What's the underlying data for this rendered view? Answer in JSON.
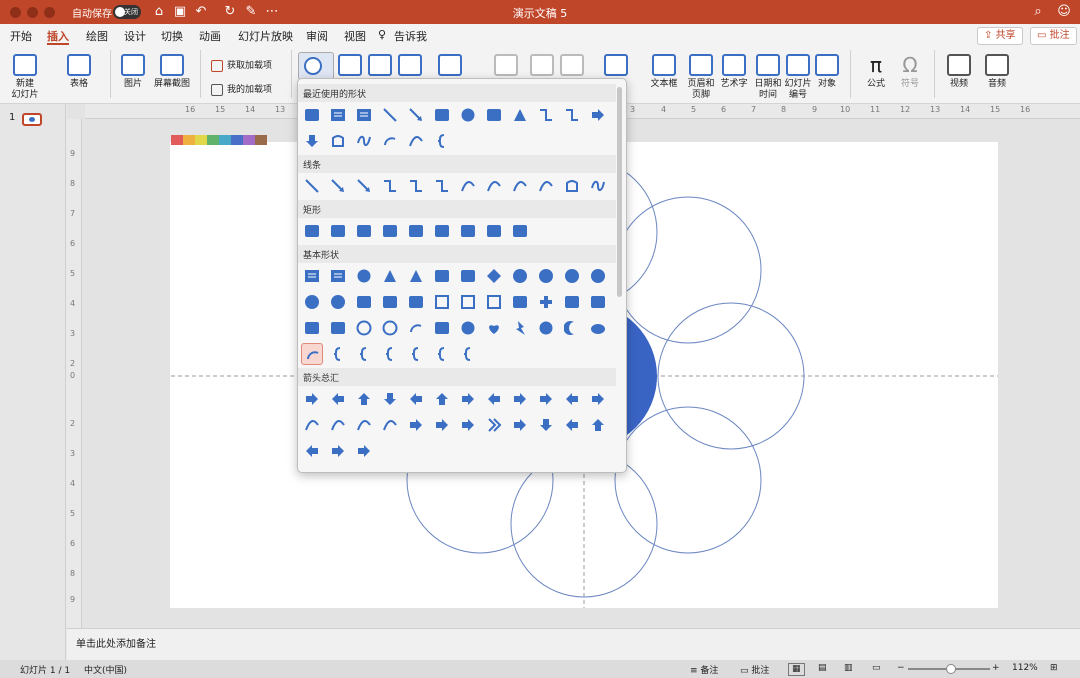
{
  "window": {
    "title": "演示文稿 5",
    "autosave_label": "自动保存",
    "autosave_state": "关闭"
  },
  "tabs": [
    "开始",
    "插入",
    "绘图",
    "设计",
    "切换",
    "动画",
    "幻灯片放映",
    "审阅",
    "视图"
  ],
  "active_tab": "插入",
  "tell_me": "告诉我",
  "share_button": "共享",
  "comment_button": "批注",
  "ribbon": {
    "new_slide": [
      "新建",
      "幻灯片"
    ],
    "table": "表格",
    "picture": "图片",
    "screenshot": "屏幕截图",
    "get_addins": "获取加载项",
    "my_addins": "我的加载项",
    "textbox": "文本框",
    "header_footer": [
      "页眉和",
      "页脚"
    ],
    "wordart": "艺术字",
    "datetime": [
      "日期和",
      "时间"
    ],
    "slide_number": [
      "幻灯片",
      "编号"
    ],
    "object": "对象",
    "equation": "公式",
    "symbol": "符号",
    "video": "视频",
    "audio": "音频"
  },
  "theme_palette": [
    "#e15b5b",
    "#f0b03f",
    "#e0d84a",
    "#5fb36a",
    "#4aa8c8",
    "#4a6fc8",
    "#a36cc8",
    "#9a6b4a"
  ],
  "shapes_menu": {
    "sections": [
      {
        "title": "最近使用的形状",
        "rows": [
          [
            "rect",
            "textbox",
            "vtextbox",
            "line",
            "arrow-line",
            "rect",
            "oval",
            "rounded-rect",
            "triangle",
            "elbow",
            "elbow-arrow",
            "right-arrow"
          ],
          [
            "down-arrow",
            "freeform",
            "scribble",
            "arc",
            "curve",
            "left-brace"
          ]
        ]
      },
      {
        "title": "线条",
        "rows": [
          [
            "line",
            "arrow-line",
            "double-arrow-line",
            "elbow",
            "elbow-arrow",
            "elbow-double",
            "curved",
            "curved-arrow",
            "curved-double",
            "curve",
            "freeform",
            "scribble"
          ]
        ]
      },
      {
        "title": "矩形",
        "rows": [
          [
            "rect",
            "rounded-rect",
            "snip-rect",
            "snip2-rect",
            "snip-round-rect",
            "round1-rect",
            "round2-rect",
            "round-diag-rect",
            "rounded-rect"
          ]
        ]
      },
      {
        "title": "基本形状",
        "rows": [
          [
            "textbox",
            "vtextbox",
            "oval",
            "triangle",
            "right-triangle",
            "parallelogram",
            "trapezoid",
            "diamond",
            "pentagon",
            "hexagon",
            "heptagon",
            "octagon"
          ],
          [
            "decagon",
            "dodecagon",
            "pie",
            "chord",
            "teardrop",
            "frame",
            "half-frame",
            "l-shape",
            "diagonal-stripe",
            "cross",
            "plaque",
            "can"
          ],
          [
            "cube",
            "bevel",
            "donut",
            "no-symbol",
            "block-arc",
            "folded-corner",
            "smiley",
            "heart",
            "lightning",
            "sun",
            "moon",
            "cloud"
          ],
          [
            "arc",
            "double-bracket",
            "double-brace",
            "left-bracket",
            "right-bracket",
            "left-brace",
            "right-brace"
          ]
        ]
      },
      {
        "title": "箭头总汇",
        "rows": [
          [
            "right-arrow",
            "left-arrow",
            "up-arrow",
            "down-arrow",
            "left-right-arrow",
            "up-down-arrow",
            "quad-arrow",
            "left-right-up-arrow",
            "bent-arrow",
            "u-turn-arrow",
            "left-up-arrow",
            "bent-up-arrow"
          ],
          [
            "curved-right-arrow",
            "curved-left-arrow",
            "curved-up-arrow",
            "curved-down-arrow",
            "striped-arrow",
            "notched-arrow",
            "pentagon-arrow",
            "chevron",
            "right-callout",
            "down-callout",
            "left-callout",
            "up-callout"
          ],
          [
            "left-right-callout",
            "quad-callout",
            "circular-arrow"
          ]
        ]
      }
    ]
  },
  "slide": {
    "accent_color": "#3a64c4"
  },
  "notes_placeholder": "单击此处添加备注",
  "status": {
    "slide_count": "幻灯片 1 / 1",
    "language": "中文(中国)",
    "notes": "备注",
    "comments": "批注",
    "zoom": "112%"
  }
}
